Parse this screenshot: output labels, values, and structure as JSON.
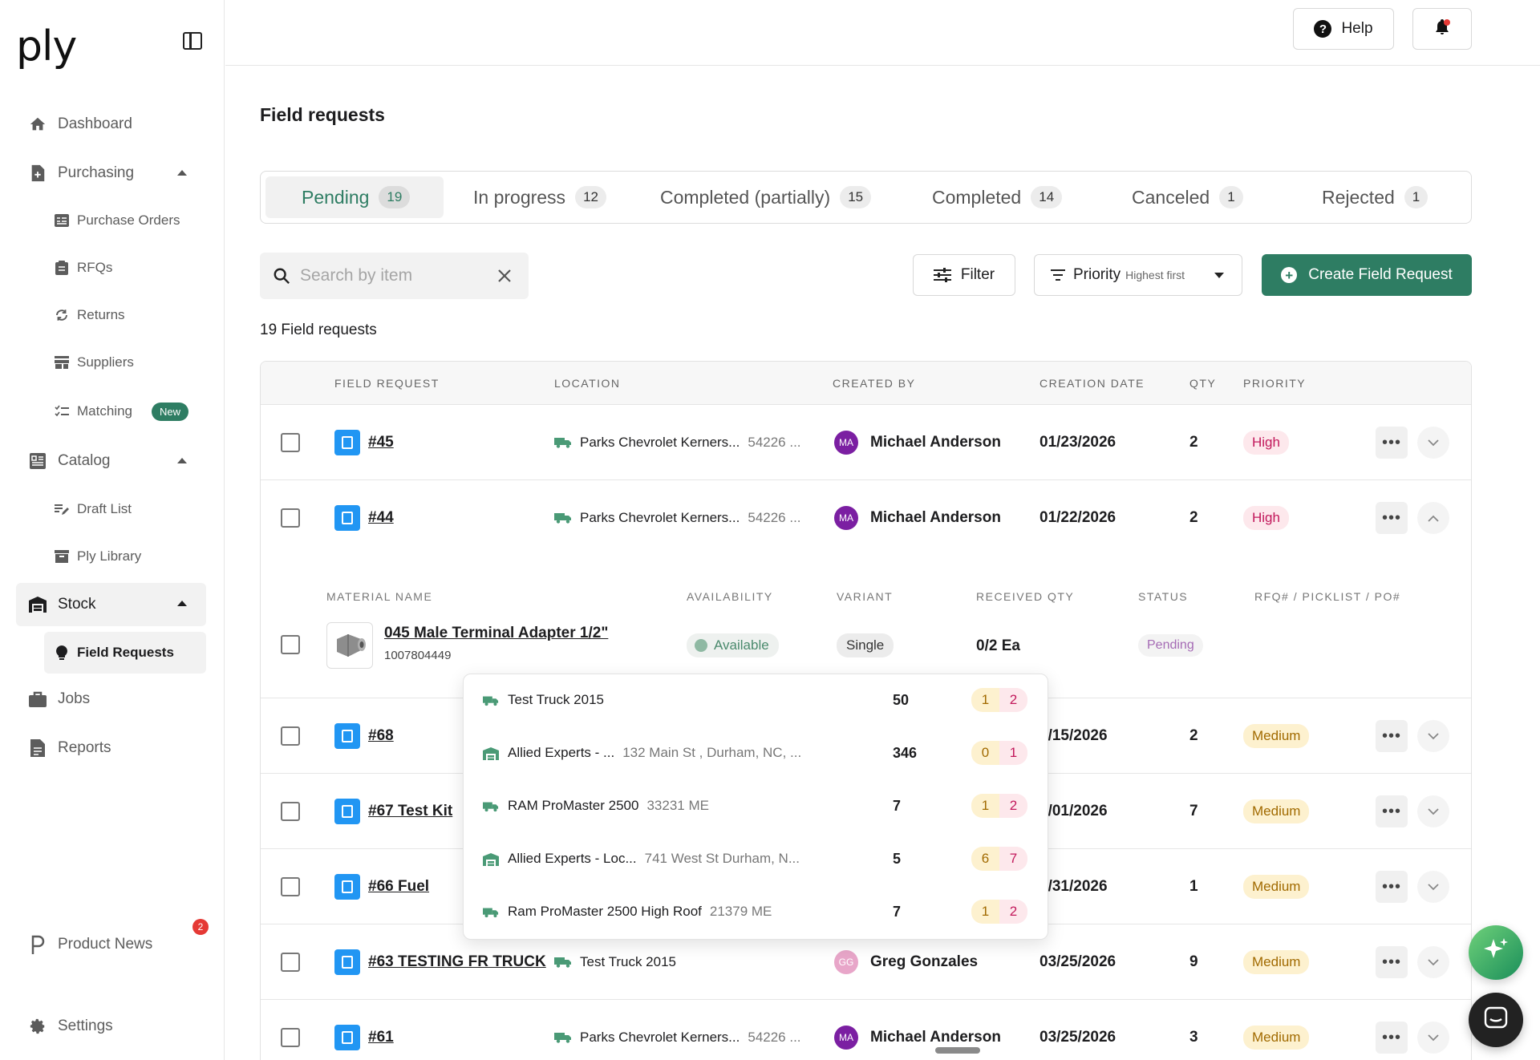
{
  "app": {
    "logo": "ply"
  },
  "sidebar": {
    "items": [
      {
        "label": "Dashboard",
        "icon": "home-icon"
      },
      {
        "label": "Purchasing",
        "icon": "document-plus-icon"
      },
      {
        "label": "Purchase Orders",
        "icon": "list-icon"
      },
      {
        "label": "RFQs",
        "icon": "clipboard-icon"
      },
      {
        "label": "Returns",
        "icon": "refresh-icon"
      },
      {
        "label": "Suppliers",
        "icon": "store-icon"
      },
      {
        "label": "Matching",
        "icon": "checklist-icon",
        "badge": "New"
      },
      {
        "label": "Catalog",
        "icon": "grid-icon"
      },
      {
        "label": "Draft List",
        "icon": "edit-list-icon"
      },
      {
        "label": "Ply Library",
        "icon": "archive-icon"
      },
      {
        "label": "Stock",
        "icon": "warehouse-icon"
      },
      {
        "label": "Field Requests",
        "icon": "lightbulb-icon"
      },
      {
        "label": "Jobs",
        "icon": "briefcase-icon"
      },
      {
        "label": "Reports",
        "icon": "report-icon"
      },
      {
        "label": "Product News",
        "icon": "p-logo-icon",
        "badge": "2"
      },
      {
        "label": "Settings",
        "icon": "gear-icon"
      }
    ]
  },
  "topbar": {
    "help_label": "Help"
  },
  "page": {
    "title": "Field requests",
    "count_label": "19 Field requests"
  },
  "tabs": [
    {
      "label": "Pending",
      "count": "19"
    },
    {
      "label": "In progress",
      "count": "12"
    },
    {
      "label": "Completed (partially)",
      "count": "15"
    },
    {
      "label": "Completed",
      "count": "14"
    },
    {
      "label": "Canceled",
      "count": "1"
    },
    {
      "label": "Rejected",
      "count": "1"
    }
  ],
  "toolbar": {
    "search_placeholder": "Search by item",
    "filter_label": "Filter",
    "sort_label": "Priority",
    "sort_sub": "Highest first",
    "create_label": "Create Field Request"
  },
  "table": {
    "headers": [
      "FIELD REQUEST",
      "LOCATION",
      "CREATED BY",
      "CREATION DATE",
      "QTY",
      "PRIORITY"
    ],
    "rows": [
      {
        "id": "#45",
        "location": "Parks Chevrolet Kerners...",
        "address": "54226 ...",
        "initials": "MA",
        "creator": "Michael Anderson",
        "date": "01/23/2026",
        "qty": "2",
        "priority": "High"
      },
      {
        "id": "#44",
        "location": "Parks Chevrolet Kerners...",
        "address": "54226 ...",
        "initials": "MA",
        "creator": "Michael Anderson",
        "date": "01/22/2026",
        "qty": "2",
        "priority": "High"
      },
      {
        "id": "#68",
        "location": "",
        "address": "",
        "initials": "",
        "creator": "",
        "date": "4/15/2026",
        "qty": "2",
        "priority": "Medium"
      },
      {
        "id": "#67 Test Kit",
        "location": "",
        "address": "",
        "initials": "",
        "creator": "",
        "date": "4/01/2026",
        "qty": "7",
        "priority": "Medium"
      },
      {
        "id": "#66 Fuel",
        "location": "",
        "address": "",
        "initials": "",
        "creator": "",
        "date": "3/31/2026",
        "qty": "1",
        "priority": "Medium"
      },
      {
        "id": "#63 TESTING FR TRUCK",
        "location": "Test Truck 2015",
        "address": "",
        "initials": "GG",
        "creator": "Greg Gonzales",
        "date": "03/25/2026",
        "qty": "9",
        "priority": "Medium"
      },
      {
        "id": "#61",
        "location": "Parks Chevrolet Kerners...",
        "address": "54226 ...",
        "initials": "MA",
        "creator": "Michael Anderson",
        "date": "03/25/2026",
        "qty": "3",
        "priority": "Medium"
      }
    ]
  },
  "expanded": {
    "headers": [
      "MATERIAL NAME",
      "AVAILABILITY",
      "VARIANT",
      "RECEIVED QTY",
      "STATUS",
      "RFQ# / PICKLIST / PO#"
    ],
    "material_name": "045 Male Terminal Adapter 1/2\"",
    "material_code": "1007804449",
    "availability": "Available",
    "variant": "Single",
    "received_qty": "0/2 Ea",
    "status": "Pending"
  },
  "popover": {
    "rows": [
      {
        "name": "Test Truck 2015",
        "address": "",
        "type": "truck",
        "qty": "50",
        "a": "1",
        "b": "2"
      },
      {
        "name": "Allied Experts - ...",
        "address": "132 Main St , Durham, NC, ...",
        "type": "warehouse",
        "qty": "346",
        "a": "0",
        "b": "1"
      },
      {
        "name": "RAM ProMaster 2500",
        "address": "33231 ME",
        "type": "truck",
        "qty": "7",
        "a": "1",
        "b": "2"
      },
      {
        "name": "Allied Experts - Loc...",
        "address": "741 West St Durham, N...",
        "type": "warehouse",
        "qty": "5",
        "a": "6",
        "b": "7"
      },
      {
        "name": "Ram ProMaster 2500 High Roof",
        "address": "21379 ME",
        "type": "truck",
        "qty": "7",
        "a": "1",
        "b": "2"
      }
    ]
  },
  "colors": {
    "brand": "#2e7d63",
    "link_blue": "#2196f3",
    "high": "#c2185b",
    "medium": "#a16a00"
  }
}
